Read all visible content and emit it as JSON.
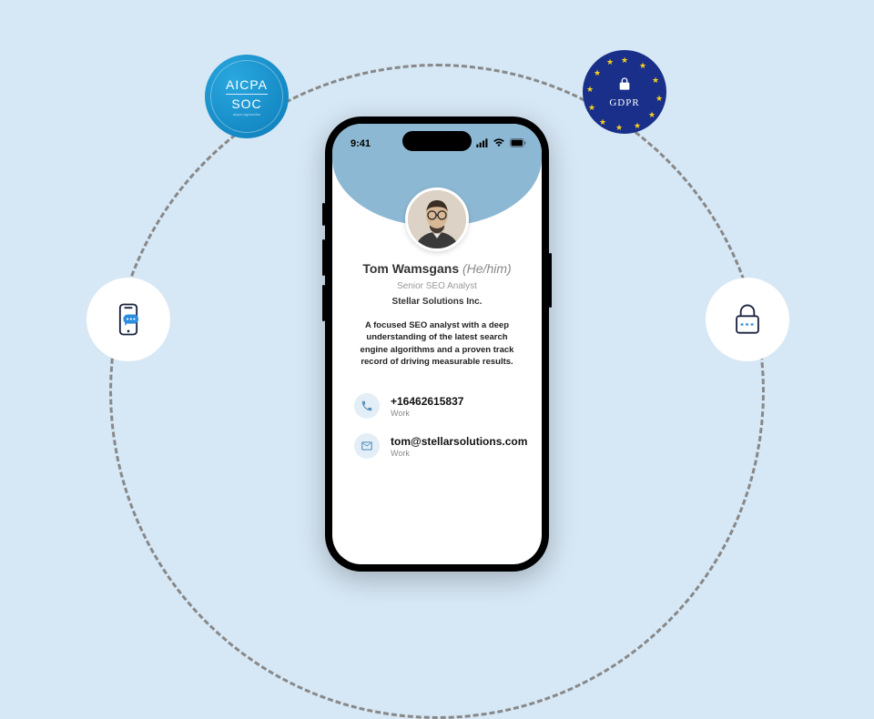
{
  "badges": {
    "aicpa": {
      "line1": "AICPA",
      "line2": "SOC",
      "sub": "aicpa.org/soc4so"
    },
    "gdpr": {
      "label": "GDPR"
    }
  },
  "statusbar": {
    "time": "9:41"
  },
  "profile": {
    "name": "Tom Wamsgans",
    "pronouns": "(He/him)",
    "role": "Senior SEO Analyst",
    "company": "Stellar Solutions Inc.",
    "bio": "A focused SEO analyst with a deep understanding of the latest search engine algorithms and a proven track record of driving measurable results."
  },
  "contacts": [
    {
      "icon": "phone",
      "value": "+16462615837",
      "label": "Work"
    },
    {
      "icon": "email",
      "value": "tom@stellarsolutions.com",
      "label": "Work"
    }
  ]
}
